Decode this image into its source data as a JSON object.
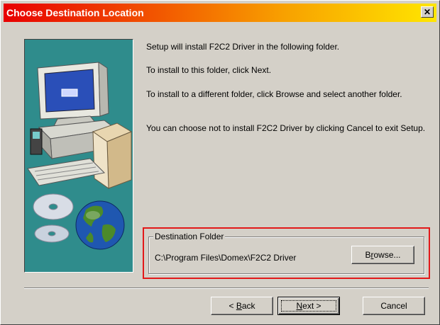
{
  "window": {
    "title": "Choose Destination Location",
    "close_glyph": "✕",
    "title_gradient": [
      "#e80000",
      "#f8a100",
      "#ffe600"
    ]
  },
  "content": {
    "line1": "Setup will install F2C2 Driver in the following folder.",
    "line2": "To install to this folder, click Next.",
    "line3": "To install to a different folder, click Browse and select another folder.",
    "line4": "You can choose not to install F2C2 Driver by clicking Cancel to exit Setup."
  },
  "destination": {
    "group_label": "Destination Folder",
    "path": "C:\\Program Files\\Domex\\F2C2 Driver",
    "browse_label_pre": "B",
    "browse_label_ul": "r",
    "browse_label_post": "owse...",
    "highlight_color": "#e21919"
  },
  "buttons": {
    "back_arrow": "< ",
    "back_ul": "B",
    "back_rest": "ack",
    "next_ul": "N",
    "next_rest": "ext >",
    "cancel": "Cancel"
  },
  "icons": {
    "banner": "computer-with-globe-and-cds-illustration",
    "close": "close-icon"
  }
}
